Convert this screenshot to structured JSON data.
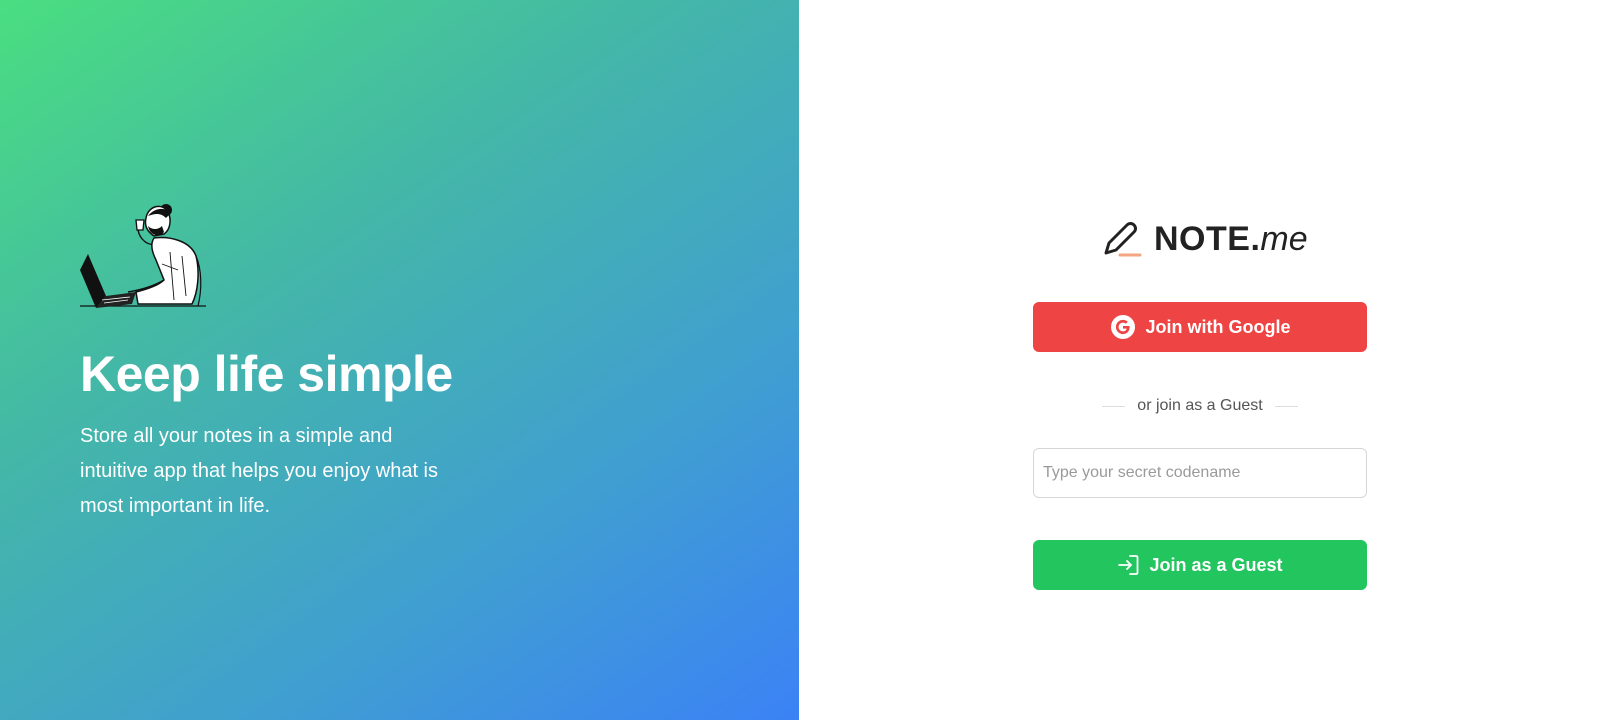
{
  "hero": {
    "title": "Keep life simple",
    "description": "Store all your notes in a simple and intuitive app that helps you enjoy what is most important in life."
  },
  "logo": {
    "name_strong": "NOTE.",
    "name_em": "me",
    "icon": "pencil-icon"
  },
  "auth": {
    "google_label": "Join with Google",
    "google_icon": "google-icon",
    "divider_text": "or join as a Guest",
    "codename_placeholder": "Type your secret codename",
    "codename_value": "",
    "guest_label": "Join as a Guest",
    "guest_icon": "sign-in-icon"
  },
  "colors": {
    "gradient_start": "#4ade80",
    "gradient_end": "#3b82f6",
    "google_button": "#ef4444",
    "guest_button": "#22c55e",
    "logo_accent": "#f4a582"
  }
}
